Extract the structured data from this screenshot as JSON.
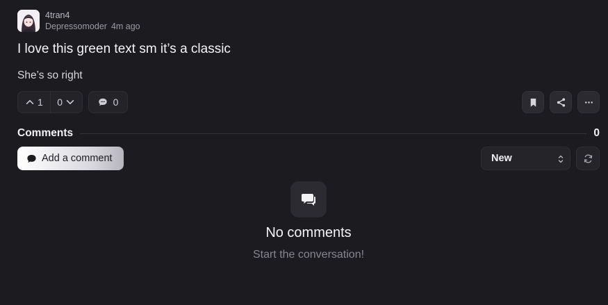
{
  "post": {
    "author": "4tran4",
    "community": "Depressomoder",
    "time": "4m ago",
    "title": "I love this green text sm it’s a classic",
    "body": "She’s so right"
  },
  "actions": {
    "upvotes": "1",
    "downvotes": "0",
    "comment_count": "0"
  },
  "comments": {
    "title": "Comments",
    "count": "0",
    "add_label": "Add a comment",
    "sort_value": "New",
    "empty_title": "No comments",
    "empty_sub": "Start the conversation!"
  },
  "icons": {
    "avatar": "avatar-image",
    "upvote": "chevron-up-icon",
    "downvote": "chevron-down-icon",
    "comment": "speech-bubble-icon",
    "bookmark": "bookmark-icon",
    "share": "share-icon",
    "more": "ellipsis-icon",
    "refresh": "refresh-icon",
    "empty": "chat-bubbles-icon"
  }
}
